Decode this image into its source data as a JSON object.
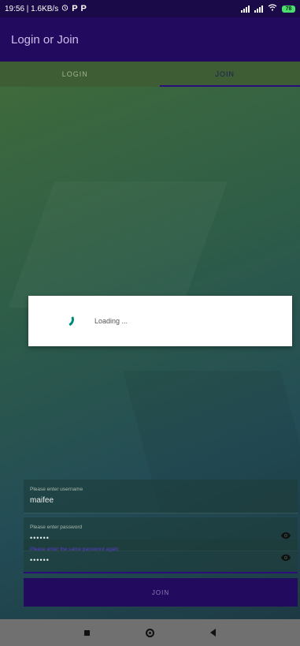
{
  "status_bar": {
    "time_speed": "19:56 | 1.6KB/s",
    "icons": [
      "alarm-icon",
      "parking-icon",
      "parking-icon",
      "signal-icon",
      "signal-icon",
      "wifi-icon",
      "battery-icon"
    ],
    "battery": "78"
  },
  "app_bar": {
    "title": "Login or Join"
  },
  "tabs": [
    {
      "label": "LOGIN",
      "active": false
    },
    {
      "label": "JOIN",
      "active": true
    }
  ],
  "dialog": {
    "text": "Loading ...",
    "spinner_color": "#00897b"
  },
  "form": {
    "username": {
      "label": "Please enter username",
      "value": "maifee"
    },
    "password": {
      "label": "Please enter password",
      "value": "••••••"
    },
    "password_again": {
      "label": "Please enter the same password again",
      "value": "••••••"
    },
    "join_button": "JOIN"
  },
  "colors": {
    "primary": "#220a5e",
    "accent": "#2a0f7a",
    "status_bar": "#1b0a48"
  }
}
